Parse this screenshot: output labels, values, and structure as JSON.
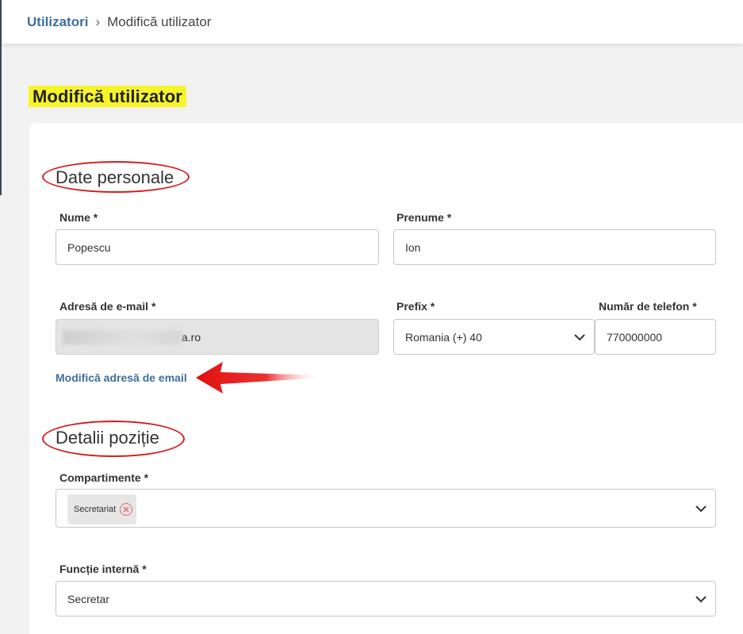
{
  "breadcrumb": {
    "root": "Utilizatori",
    "separator": "›",
    "current": "Modifică utilizator"
  },
  "page": {
    "title": "Modifică utilizator"
  },
  "personal": {
    "title": "Date personale",
    "nume": {
      "label": "Nume *",
      "value": "Popescu"
    },
    "prenume": {
      "label": "Prenume *",
      "value": "Ion"
    },
    "email": {
      "label": "Adresă de e-mail *",
      "visible_suffix": "a.ro"
    },
    "prefix": {
      "label": "Prefix *",
      "value": "Romania (+) 40"
    },
    "phone": {
      "label": "Număr de telefon *",
      "value": "770000000"
    },
    "change_email_link": "Modifică adresă de email"
  },
  "position": {
    "title": "Detalii poziție",
    "compartimente": {
      "label": "Compartimente *",
      "chips": [
        "Secretariat"
      ]
    },
    "functie": {
      "label": "Funcție internă *",
      "value": "Secretar"
    }
  },
  "icons": {
    "chevron": "chevron-down-icon",
    "chip_remove": "close-circle-icon",
    "arrow": "red-arrow-annotation"
  },
  "colors": {
    "accent": "#3e6f9f",
    "highlight": "#f7f52a",
    "annotation": "#d81a1a"
  }
}
